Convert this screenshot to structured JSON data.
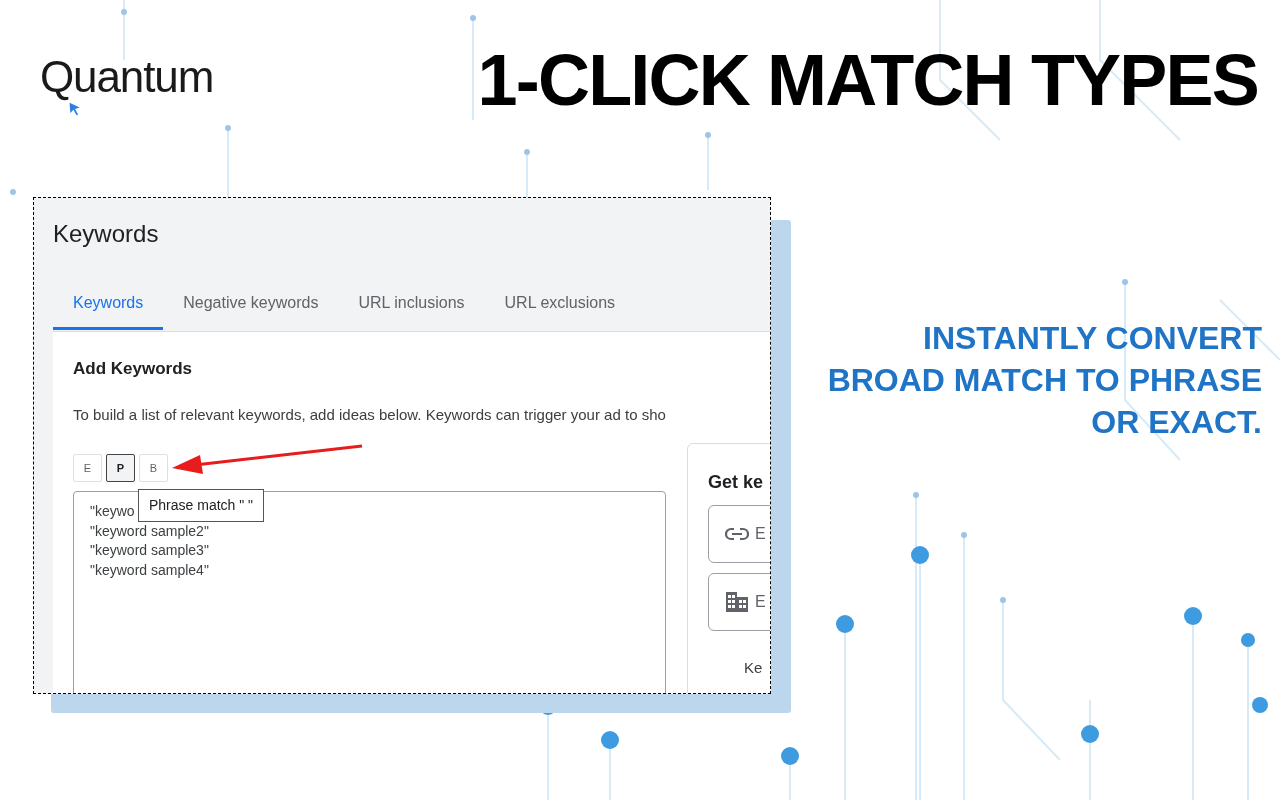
{
  "logo": {
    "text": "Quantum"
  },
  "headline": "1-CLICK MATCH TYPES",
  "tagline": [
    "INSTANTLY CONVERT",
    "BROAD MATCH TO PHRASE",
    "OR EXACT."
  ],
  "screenshot": {
    "title": "Keywords",
    "tabs": [
      {
        "label": "Keywords",
        "selected": true
      },
      {
        "label": "Negative keywords",
        "selected": false
      },
      {
        "label": "URL inclusions",
        "selected": false
      },
      {
        "label": "URL exclusions",
        "selected": false
      }
    ],
    "section_title": "Add Keywords",
    "description": "To build a list of relevant keywords, add ideas below. Keywords can trigger your ad to sho",
    "match_buttons": [
      {
        "label": "E",
        "selected": false
      },
      {
        "label": "P",
        "selected": true
      },
      {
        "label": "B",
        "selected": false
      }
    ],
    "tooltip": "Phrase match \" \"",
    "keywords": [
      "\"keywo",
      "\"keyword sample2\"",
      "\"keyword sample3\"",
      "\"keyword sample4\""
    ],
    "side_panel": {
      "title": "Get ke",
      "fields": [
        {
          "kind": "link",
          "text": "E"
        },
        {
          "kind": "business",
          "text": "E"
        }
      ],
      "footer": "Ke"
    }
  }
}
